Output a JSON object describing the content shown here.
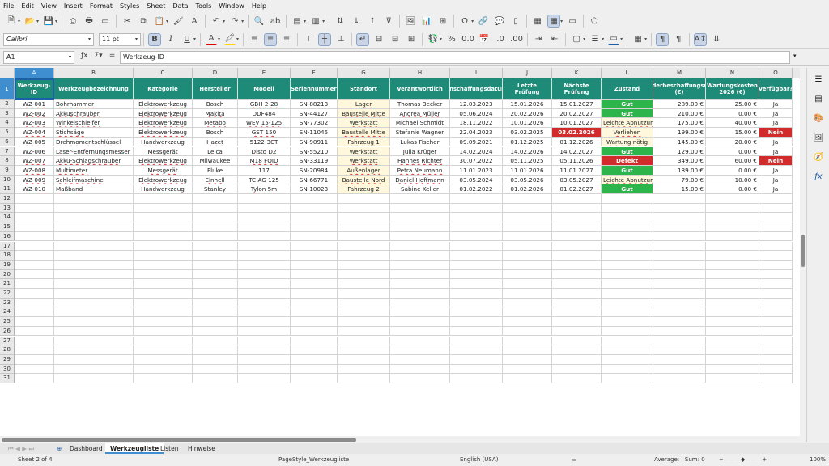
{
  "menu": [
    "File",
    "Edit",
    "View",
    "Insert",
    "Format",
    "Styles",
    "Sheet",
    "Data",
    "Tools",
    "Window",
    "Help"
  ],
  "font_name": "Calibri",
  "font_size": "11 pt",
  "cell_ref": "A1",
  "formula": "Werkzeug-ID",
  "columns": [
    "A",
    "B",
    "C",
    "D",
    "E",
    "F",
    "G",
    "H",
    "I",
    "J",
    "K",
    "L",
    "M",
    "N",
    "O"
  ],
  "rows": [
    "1",
    "2",
    "3",
    "4",
    "5",
    "6",
    "7",
    "8",
    "9",
    "10",
    "11",
    "12",
    "13",
    "14",
    "15",
    "16",
    "17",
    "18",
    "19",
    "20",
    "21",
    "22",
    "23",
    "24",
    "25",
    "26",
    "27",
    "28",
    "29",
    "30",
    "31"
  ],
  "headers": [
    "Werkzeug-ID",
    "Werkzeugbezeichnung",
    "Kategorie",
    "Hersteller",
    "Modell",
    "Seriennummer",
    "Standort",
    "Verantwortlich",
    "Anschaffungsdatum",
    "Letzte Prüfung",
    "Nächste Prüfung",
    "Zustand",
    "Wiederbeschaffungswert (€)",
    "Wartungskosten 2026 (€)",
    "Verfügbar?"
  ],
  "data": [
    [
      "WZ-001",
      "Bohrhammer",
      "Elektrowerkzeug",
      "Bosch",
      "GBH 2-28",
      "SN-88213",
      "Lager",
      "Thomas Becker",
      "12.03.2023",
      "15.01.2026",
      "15.01.2027",
      "Gut",
      "289.00 €",
      "25.00 €",
      "Ja"
    ],
    [
      "WZ-002",
      "Akkuschrauber",
      "Elektrowerkzeug",
      "Makita",
      "DDF484",
      "SN-44127",
      "Baustelle Mitte",
      "Andrea Müller",
      "05.06.2024",
      "20.02.2026",
      "20.02.2027",
      "Gut",
      "210.00 €",
      "0.00 €",
      "Ja"
    ],
    [
      "WZ-003",
      "Winkelschleifer",
      "Elektrowerkzeug",
      "Metabo",
      "WEV 15-125",
      "SN-77302",
      "Werkstatt",
      "Michael Schmidt",
      "18.11.2022",
      "10.01.2026",
      "10.01.2027",
      "Leichte Abnutzung",
      "175.00 €",
      "40.00 €",
      "Ja"
    ],
    [
      "WZ-004",
      "Stichsäge",
      "Elektrowerkzeug",
      "Bosch",
      "GST 150",
      "SN-11045",
      "Baustelle Mitte",
      "Stefanie Wagner",
      "22.04.2023",
      "03.02.2025",
      "03.02.2026",
      "Verliehen",
      "199.00 €",
      "15.00 €",
      "Nein"
    ],
    [
      "WZ-005",
      "Drehmomentschlüssel",
      "Handwerkzeug",
      "Hazet",
      "5122-3CT",
      "SN-90911",
      "Fahrzeug 1",
      "Lukas Fischer",
      "09.09.2021",
      "01.12.2025",
      "01.12.2026",
      "Wartung nötig",
      "145.00 €",
      "20.00 €",
      "Ja"
    ],
    [
      "WZ-006",
      "Laser-Entfernungsmesser",
      "Messgerät",
      "Leica",
      "Disto D2",
      "SN-55210",
      "Werkstatt",
      "Julia Krüger",
      "14.02.2024",
      "14.02.2026",
      "14.02.2027",
      "Gut",
      "129.00 €",
      "0.00 €",
      "Ja"
    ],
    [
      "WZ-007",
      "Akku-Schlagschrauber",
      "Elektrowerkzeug",
      "Milwaukee",
      "M18 FQID",
      "SN-33119",
      "Werkstatt",
      "Hannes Richter",
      "30.07.2022",
      "05.11.2025",
      "05.11.2026",
      "Defekt",
      "349.00 €",
      "60.00 €",
      "Nein"
    ],
    [
      "WZ-008",
      "Multimeter",
      "Messgerät",
      "Fluke",
      "117",
      "SN-20984",
      "Außenlager",
      "Petra Neumann",
      "11.01.2023",
      "11.01.2026",
      "11.01.2027",
      "Gut",
      "189.00 €",
      "0.00 €",
      "Ja"
    ],
    [
      "WZ-009",
      "Schleifmaschine",
      "Elektrowerkzeug",
      "Einhell",
      "TC-AG 125",
      "SN-66771",
      "Baustelle Nord",
      "Daniel Hoffmann",
      "03.05.2024",
      "03.05.2026",
      "03.05.2027",
      "Leichte Abnutzung",
      "79.00 €",
      "10.00 €",
      "Ja"
    ],
    [
      "WZ-010",
      "Maßband",
      "Handwerkzeug",
      "Stanley",
      "Tylon 5m",
      "SN-10023",
      "Fahrzeug 2",
      "Sabine Keller",
      "01.02.2022",
      "01.02.2026",
      "01.02.2027",
      "Gut",
      "15.00 €",
      "0.00 €",
      "Ja"
    ]
  ],
  "tabs": [
    "Dashboard",
    "Werkzeugliste",
    "Listen",
    "Hinweise"
  ],
  "active_tab": "Werkzeugliste",
  "status": {
    "sheet": "Sheet 2 of 4",
    "pagestyle": "PageStyle_Werkzeugliste",
    "lang": "English (USA)",
    "sum": "Average: ; Sum: 0",
    "zoom": "100%"
  },
  "colors": {
    "header": "#1e8a78",
    "good": "#2db44b",
    "bad": "#d12b2b",
    "highlight": "#fff8dc",
    "selection": "#3e8ed0"
  }
}
